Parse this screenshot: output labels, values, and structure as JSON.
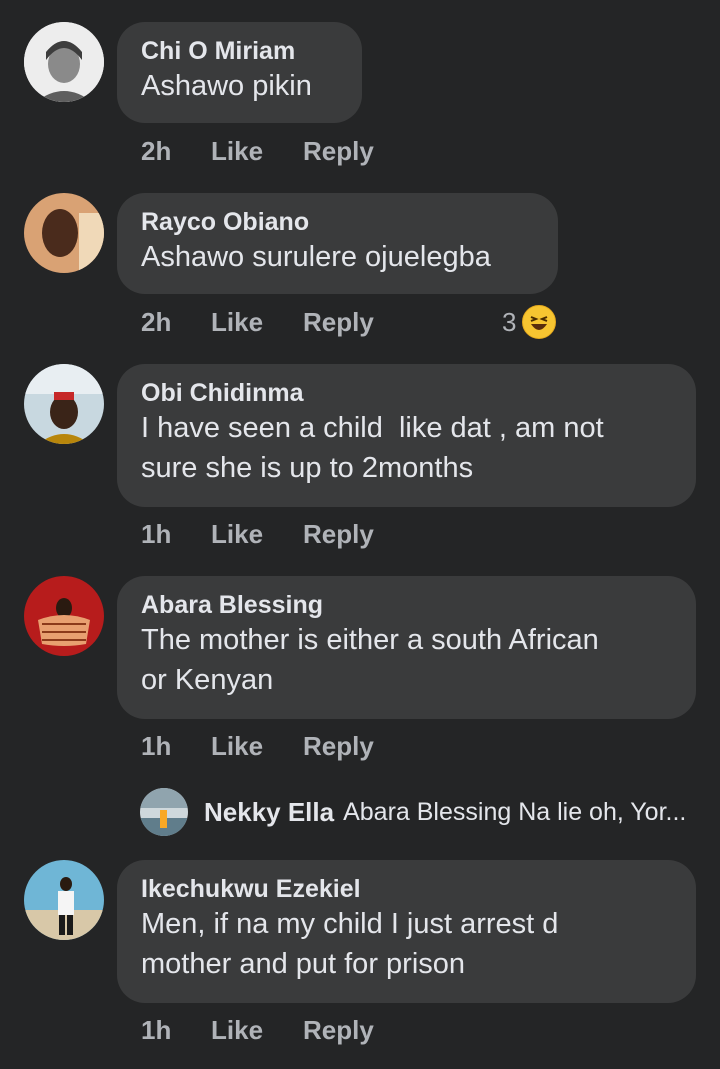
{
  "comments": [
    {
      "author": "Chi O Miriam",
      "text": "Ashawo pikin",
      "time": "2h",
      "like": "Like",
      "reply": "Reply"
    },
    {
      "author": "Rayco Obiano",
      "text": "Ashawo surulere ojuelegba",
      "time": "2h",
      "like": "Like",
      "reply": "Reply",
      "reaction_count": "3",
      "reaction_icon": "haha-emoji-icon"
    },
    {
      "author": "Obi Chidinma",
      "text": "I have seen a child  like dat , am not\nsure she is up to 2months",
      "time": "1h",
      "like": "Like",
      "reply": "Reply"
    },
    {
      "author": "Abara Blessing",
      "text": "The mother is either a south African\nor Kenyan",
      "time": "1h",
      "like": "Like",
      "reply": "Reply"
    },
    {
      "author": "Ikechukwu Ezekiel",
      "text": "Men, if na my child I just arrest d\nmother and put for prison",
      "time": "1h",
      "like": "Like",
      "reply": "Reply"
    }
  ],
  "reply_preview": {
    "author": "Nekky Ella",
    "text": "Abara Blessing Na lie oh, Yor..."
  },
  "colors": {
    "background": "#242526",
    "bubble": "#3a3b3c",
    "text": "#e4e6eb",
    "secondary": "#b0b3b8",
    "emoji": "#f7c531"
  }
}
